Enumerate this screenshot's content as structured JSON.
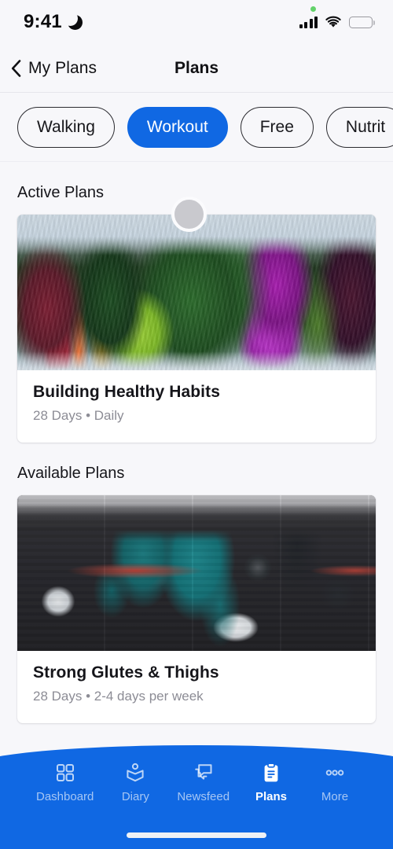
{
  "status_bar": {
    "time": "9:41",
    "moon_icon": "moon-icon",
    "green_dot": "recording-indicator-dot",
    "signal_icon": "cellular-signal-icon",
    "wifi_icon": "wifi-icon",
    "battery_icon": "battery-full-icon"
  },
  "header": {
    "back_label": "My Plans",
    "back_icon": "chevron-left-icon",
    "title": "Plans"
  },
  "filters": {
    "chips": [
      {
        "label": "Walking",
        "active": false
      },
      {
        "label": "Workout",
        "active": true
      },
      {
        "label": "Free",
        "active": false
      },
      {
        "label": "Nutrit",
        "active": false
      }
    ]
  },
  "active_plans": {
    "section_title": "Active Plans",
    "loader": "loading-spinner-circle",
    "cards": [
      {
        "title": "Building Healthy Habits",
        "meta": "28 Days • Daily",
        "photo": "leafy-greens-photo"
      }
    ]
  },
  "available_plans": {
    "section_title": "Available Plans",
    "cards": [
      {
        "title": "Strong Glutes & Thighs",
        "meta": "28 Days • 2-4 days per week",
        "photo": "kettlebell-workout-photo"
      }
    ]
  },
  "bottom_nav": {
    "items": [
      {
        "label": "Dashboard",
        "icon": "grid-icon",
        "active": false
      },
      {
        "label": "Diary",
        "icon": "open-book-icon",
        "active": false
      },
      {
        "label": "Newsfeed",
        "icon": "chat-bubbles-icon",
        "active": false
      },
      {
        "label": "Plans",
        "icon": "clipboard-icon",
        "active": true
      },
      {
        "label": "More",
        "icon": "ellipsis-icon",
        "active": false
      }
    ],
    "home_indicator": "home-indicator-bar"
  },
  "colors": {
    "accent_blue": "#1068e3",
    "page_background": "#f7f7fa",
    "card_background": "#ffffff",
    "text_primary": "#15151a",
    "text_muted": "#8c8c95",
    "status_green": "#63d26a"
  }
}
